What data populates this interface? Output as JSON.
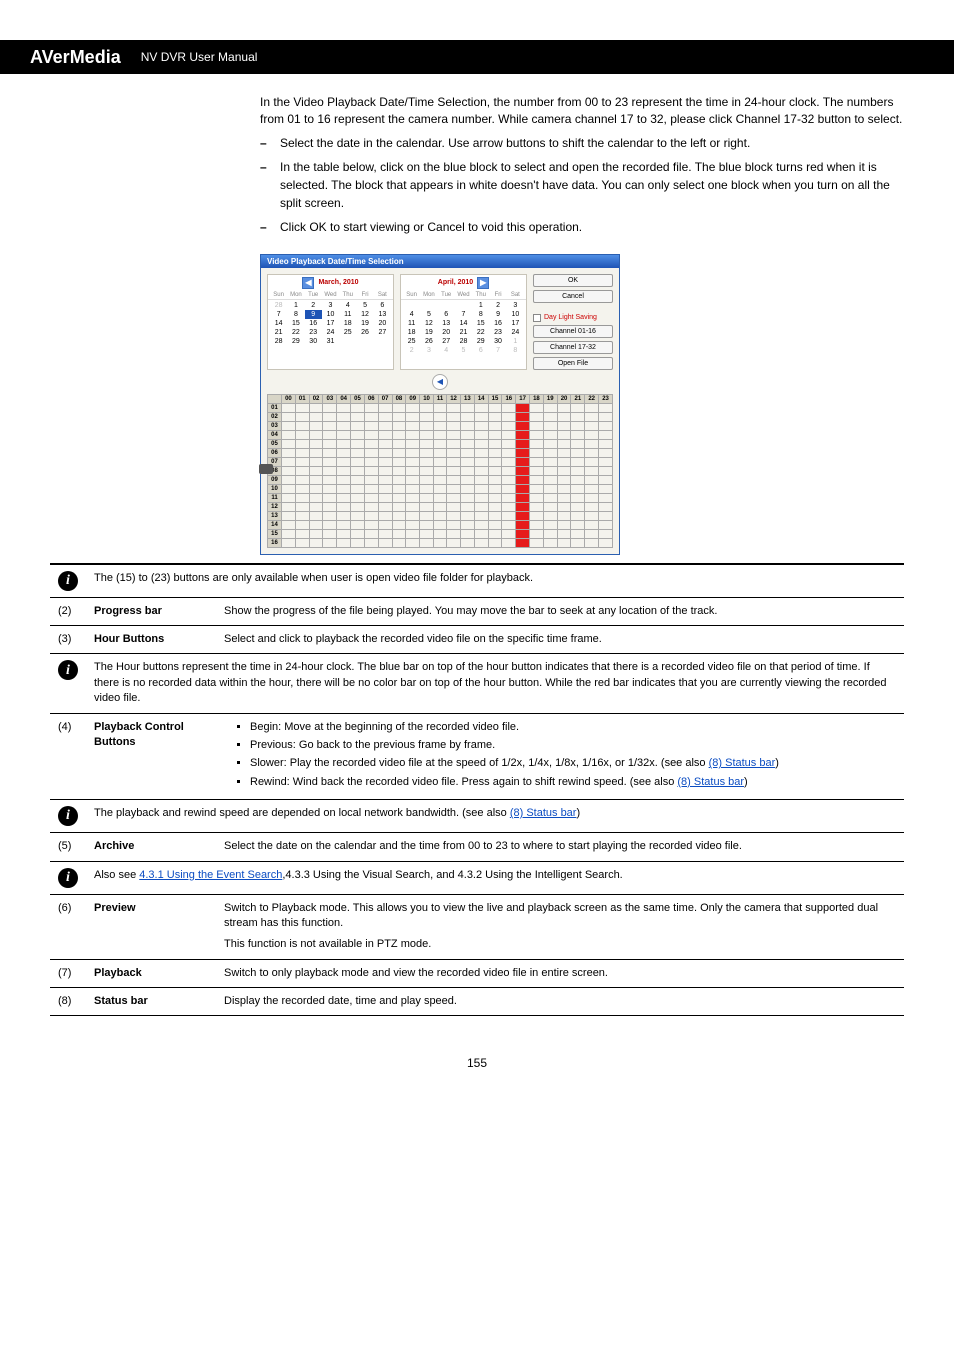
{
  "header": {
    "left": "AVerMedia",
    "right": "NV DVR User Manual"
  },
  "intro": "In the Video Playback Date/Time Selection, the number from 00 to 23 represent the time in 24-hour clock. The numbers from 01 to 16 represent the camera number. While camera channel 17 to 32, please click Channel 17-32 button to select.",
  "steps": [
    "Select the date in the calendar. Use arrow buttons to shift the calendar to the left or right.",
    "In the table below, click on the blue block to select and open the recorded file. The blue block turns red when it is selected. The block that appears in white doesn't have data. You can only select one block when you turn on all the split screen.",
    "Click OK to start viewing or Cancel to void this operation."
  ],
  "dialog": {
    "title": "Video Playback Date/Time Selection",
    "months": [
      "March, 2010",
      "April, 2010"
    ],
    "dow": [
      "Sun",
      "Mon",
      "Tue",
      "Wed",
      "Thu",
      "Fri",
      "Sat"
    ],
    "marchDays": [
      "28",
      "1",
      "2",
      "3",
      "4",
      "5",
      "6",
      "7",
      "8",
      "9",
      "10",
      "11",
      "12",
      "13",
      "14",
      "15",
      "16",
      "17",
      "18",
      "19",
      "20",
      "21",
      "22",
      "23",
      "24",
      "25",
      "26",
      "27",
      "28",
      "29",
      "30",
      "31"
    ],
    "aprilDays": [
      "",
      "",
      "",
      "",
      "1",
      "2",
      "3",
      "4",
      "5",
      "6",
      "7",
      "8",
      "9",
      "10",
      "11",
      "12",
      "13",
      "14",
      "15",
      "16",
      "17",
      "18",
      "19",
      "20",
      "21",
      "22",
      "23",
      "24",
      "25",
      "26",
      "27",
      "28",
      "29",
      "30",
      "1",
      "2",
      "3",
      "4",
      "5",
      "6",
      "7",
      "8"
    ],
    "btns": {
      "ok": "OK",
      "cancel": "Cancel",
      "dls": "Day Light Saving",
      "c1": "Channel 01-16",
      "c2": "Channel 17-32",
      "open": "Open File"
    },
    "hours": [
      "00",
      "01",
      "02",
      "03",
      "04",
      "05",
      "06",
      "07",
      "08",
      "09",
      "10",
      "11",
      "12",
      "13",
      "14",
      "15",
      "16",
      "17",
      "18",
      "19",
      "20",
      "21",
      "22",
      "23"
    ],
    "rows": [
      "01",
      "02",
      "03",
      "04",
      "05",
      "06",
      "07",
      "08",
      "09",
      "10",
      "11",
      "12",
      "13",
      "14",
      "15",
      "16"
    ]
  },
  "note": "The (15) to (23) buttons are only available when user is open video file folder for playback.",
  "rows": [
    {
      "n": "(2)",
      "name": "Progress bar",
      "desc": "Show the progress of the file being played. You may move the bar to seek at any location of the track."
    },
    {
      "n": "(3)",
      "name": "Hour Buttons",
      "desc": "Select and click to playback the recorded video file on the specific time frame."
    },
    {
      "n": "",
      "name": "",
      "note": "The Hour buttons represent the time in 24-hour clock. The blue bar on top of the hour button indicates that there is a recorded video file on that period of time. If there is no recorded data within the hour, there will be no color bar on top of the hour button. While the red bar indicates that you are currently viewing the recorded video file."
    },
    {
      "n": "(4)",
      "name": "Playback Control Buttons",
      "list": [
        {
          "t": "Begin: Move at the beginning of the recorded video file."
        },
        {
          "t": "Previous: Go back to the previous frame by frame."
        },
        {
          "t": "Slower: Play the recorded video file at the speed of 1/2x, 1/4x, 1/8x, 1/16x, or 1/32x. (see also ",
          "l": "(8) Status bar",
          "after": ")"
        },
        {
          "t": "Rewind: Wind back the recorded video file. Press again to shift rewind speed. (see also ",
          "l": "(8) Status bar",
          "after": ")"
        }
      ]
    },
    {
      "n": "",
      "name": "",
      "note2": "The playback and rewind speed are depended on local network bandwidth. (see also ",
      "link": "(8) Status bar",
      "after": ")"
    },
    {
      "n": "(5)",
      "name": "Archive",
      "desc": "Select the date on the calendar and the time from 00 to 23 to where to start playing the recorded video file."
    },
    {
      "n": "",
      "name": "",
      "note3a": "Also see ",
      "link3": "4.3.1 Using the Event Search",
      "note3b": ",4.3.3 Using the Visual Search, and 4.3.2 Using the Intelligent Search."
    },
    {
      "n": "(6)",
      "name": "Preview",
      "desc": "Switch to Playback mode. This allows you to view the live and playback screen as the same time. Only the camera that supported dual stream has this function.",
      "foot": "This function is not available in PTZ mode."
    },
    {
      "n": "(7)",
      "name": "Playback",
      "desc": "Switch to only playback mode and view the recorded video file in entire screen."
    },
    {
      "n": "(8)",
      "name": "Status bar",
      "desc": "Display the recorded date, time and play speed."
    }
  ],
  "page": "155"
}
